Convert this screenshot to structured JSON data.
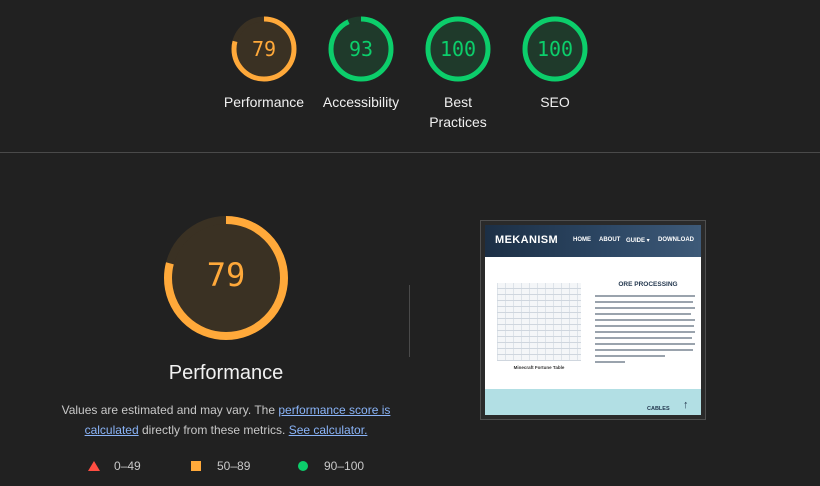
{
  "colors": {
    "average": "#ffa93a",
    "average_track": "#3a3123",
    "pass": "#0cce6b",
    "pass_track": "#1f3a2b",
    "fail": "#ff4e42",
    "link": "#8ab4f8"
  },
  "scores": [
    {
      "label": "Performance",
      "value": "79",
      "fraction": 0.79,
      "rating": "average"
    },
    {
      "label": "Accessibility",
      "value": "93",
      "fraction": 0.93,
      "rating": "pass"
    },
    {
      "label": "Best Practices",
      "value": "100",
      "fraction": 1.0,
      "rating": "pass"
    },
    {
      "label": "SEO",
      "value": "100",
      "fraction": 1.0,
      "rating": "pass"
    }
  ],
  "performance": {
    "score": "79",
    "fraction": 0.79,
    "title": "Performance",
    "desc_prefix": "Values are estimated and may vary. The ",
    "link1": "performance score is calculated",
    "desc_middle": " directly from these metrics. ",
    "link2": "See calculator."
  },
  "legend": [
    {
      "range": "0–49",
      "shape": "triangle-icon"
    },
    {
      "range": "50–89",
      "shape": "square-icon"
    },
    {
      "range": "90–100",
      "shape": "circle-icon"
    }
  ],
  "screenshot": {
    "logo": "MEKANISM",
    "nav": [
      "HOME",
      "ABOUT",
      "GUIDE ▾",
      "DOWNLOAD"
    ],
    "heading": "ORE PROCESSING",
    "table_caption": "Minecraft Fortune Table",
    "footer_label": "CABLES",
    "arrow": "↑"
  }
}
